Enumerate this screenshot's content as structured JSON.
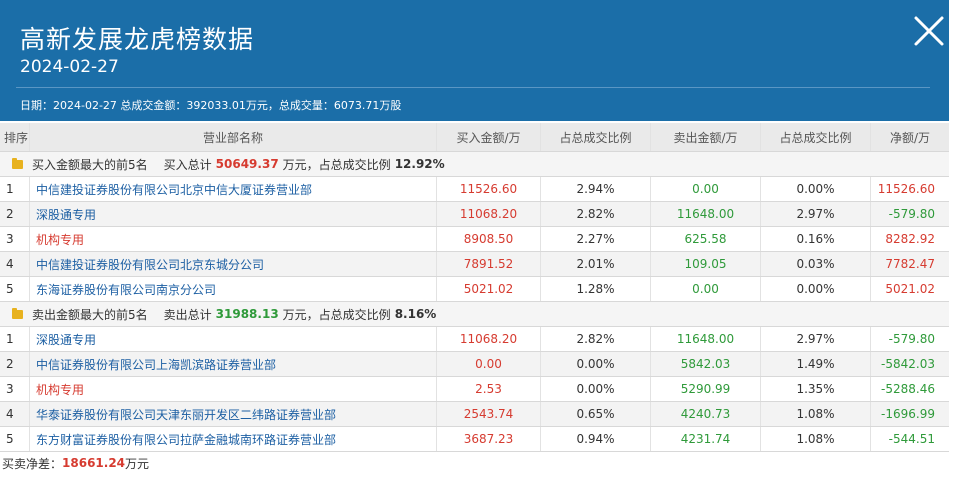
{
  "header": {
    "title": "高新发展龙虎榜数据",
    "date": "2024-02-27",
    "summary": "日期：2024-02-27 总成交金额：392033.01万元，总成交量：6073.71万股"
  },
  "columns": [
    "排序",
    "营业部名称",
    "买入金额/万",
    "占总成交比例",
    "卖出金额/万",
    "占总成交比例",
    "净额/万"
  ],
  "buy_section": {
    "label": "买入金额最大的前5名",
    "total_label": "买入总计",
    "total_value": "50649.37",
    "unit": "万元，占总成交比例",
    "ratio": "12.92%",
    "rows": [
      {
        "rank": "1",
        "name": "中信建投证券股份有限公司北京中信大厦证券营业部",
        "buy": "11526.60",
        "buy_pct": "2.94%",
        "sell": "0.00",
        "sell_pct": "0.00%",
        "net": "11526.60",
        "name_red": false,
        "net_neg": false
      },
      {
        "rank": "2",
        "name": "深股通专用",
        "buy": "11068.20",
        "buy_pct": "2.82%",
        "sell": "11648.00",
        "sell_pct": "2.97%",
        "net": "-579.80",
        "name_red": false,
        "net_neg": true
      },
      {
        "rank": "3",
        "name": "机构专用",
        "buy": "8908.50",
        "buy_pct": "2.27%",
        "sell": "625.58",
        "sell_pct": "0.16%",
        "net": "8282.92",
        "name_red": true,
        "net_neg": false
      },
      {
        "rank": "4",
        "name": "中信建投证券股份有限公司北京东城分公司",
        "buy": "7891.52",
        "buy_pct": "2.01%",
        "sell": "109.05",
        "sell_pct": "0.03%",
        "net": "7782.47",
        "name_red": false,
        "net_neg": false
      },
      {
        "rank": "5",
        "name": "东海证券股份有限公司南京分公司",
        "buy": "5021.02",
        "buy_pct": "1.28%",
        "sell": "0.00",
        "sell_pct": "0.00%",
        "net": "5021.02",
        "name_red": false,
        "net_neg": false
      }
    ]
  },
  "sell_section": {
    "label": "卖出金额最大的前5名",
    "total_label": "卖出总计",
    "total_value": "31988.13",
    "unit": "万元，占总成交比例",
    "ratio": "8.16%",
    "rows": [
      {
        "rank": "1",
        "name": "深股通专用",
        "buy": "11068.20",
        "buy_pct": "2.82%",
        "sell": "11648.00",
        "sell_pct": "2.97%",
        "net": "-579.80",
        "name_red": false,
        "net_neg": true
      },
      {
        "rank": "2",
        "name": "中信证券股份有限公司上海凯滨路证券营业部",
        "buy": "0.00",
        "buy_pct": "0.00%",
        "sell": "5842.03",
        "sell_pct": "1.49%",
        "net": "-5842.03",
        "name_red": false,
        "net_neg": true
      },
      {
        "rank": "3",
        "name": "机构专用",
        "buy": "2.53",
        "buy_pct": "0.00%",
        "sell": "5290.99",
        "sell_pct": "1.35%",
        "net": "-5288.46",
        "name_red": true,
        "net_neg": true
      },
      {
        "rank": "4",
        "name": "华泰证券股份有限公司天津东丽开发区二纬路证券营业部",
        "buy": "2543.74",
        "buy_pct": "0.65%",
        "sell": "4240.73",
        "sell_pct": "1.08%",
        "net": "-1696.99",
        "name_red": false,
        "net_neg": true
      },
      {
        "rank": "5",
        "name": "东方财富证券股份有限公司拉萨金融城南环路证券营业部",
        "buy": "3687.23",
        "buy_pct": "0.94%",
        "sell": "4231.74",
        "sell_pct": "1.08%",
        "net": "-544.51",
        "name_red": false,
        "net_neg": true
      }
    ]
  },
  "footer": {
    "label": "买卖净差：",
    "value": "18661.24",
    "unit": "万元"
  },
  "colors": {
    "header_bg": "#1b6ea8",
    "red": "#d63b30",
    "green": "#2f9a3a",
    "link_blue": "#1c5fa3",
    "icon": "close-icon"
  }
}
